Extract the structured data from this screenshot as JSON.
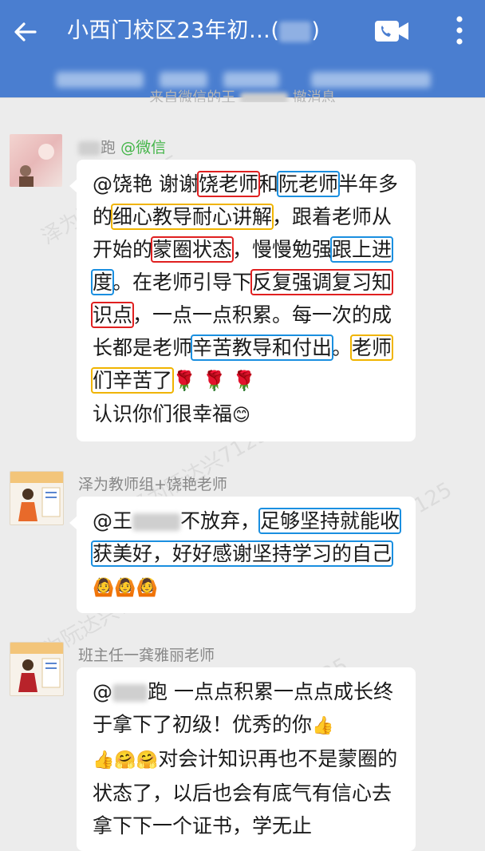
{
  "header": {
    "title": "小西门校区23年初…(",
    "title_suffix": ")",
    "bg_color": "#4a7ed0",
    "icons": [
      "back-arrow-icon",
      "video-call-icon",
      "more-icon"
    ]
  },
  "system_notice": "来自微信的王",
  "system_notice_tail": "撤消息",
  "watermark": "泽为阮达兴7125",
  "messages": [
    {
      "sender": "跑",
      "source": "@微信",
      "text_parts": {
        "p1": "@饶艳 谢谢",
        "p2": "饶老师",
        "p3": "和",
        "p4": "阮老师",
        "p5": "半年多的",
        "p6": "细心教导耐心讲解",
        "p7": "，跟着老师从开始的",
        "p8": "蒙圈状态",
        "p9": "，慢慢勉强",
        "p10": "跟上进度",
        "p11": "。在老师引导下",
        "p12": "反复强调复习知识点",
        "p13": "，一点一点积累。每一次的成长都是老师",
        "p14": "辛苦教导和付出",
        "p15": "。",
        "p16": "老师们辛苦了",
        "p17": "🌹 🌹 🌹",
        "p18": "认识你们很幸福",
        "p19": "😊"
      }
    },
    {
      "sender": "泽为教师组+饶艳老师",
      "text_parts": {
        "p1": "@王",
        "p2": "不放弃，",
        "p3": "足够坚持就能收获美好，好好感谢坚持学习的自己",
        "p4": "🙆🙆🙆"
      }
    },
    {
      "sender": "班主任一龚雅丽老师",
      "text_parts": {
        "p1": "@",
        "p2": "跑 一点点积累一点点成长终于拿下了初级！优秀的你",
        "p3": "👍",
        "p4": "👍🤗🤗",
        "p5": "对会计知识再也不是蒙圈的状态了，以后也会有底气有信心去拿下下一个证书，学无止"
      }
    }
  ]
}
